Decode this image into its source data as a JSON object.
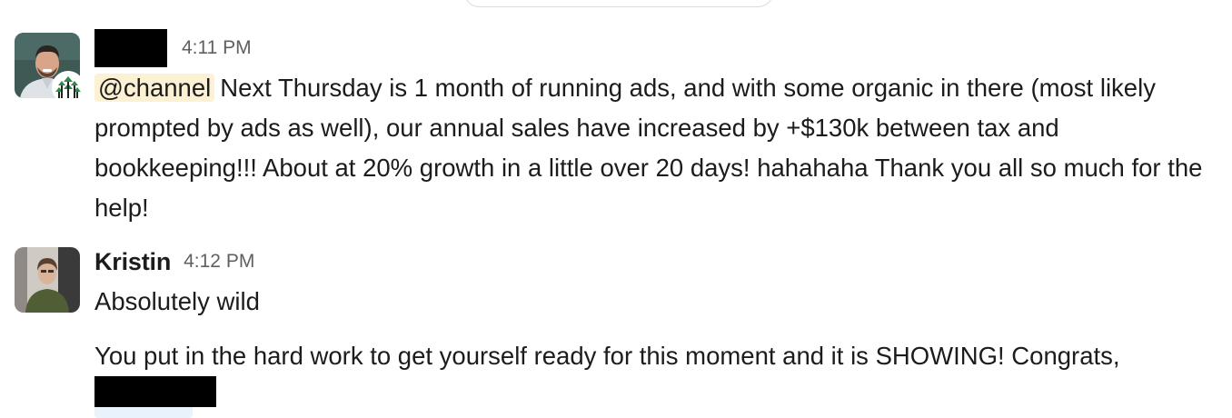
{
  "messages": [
    {
      "author": "",
      "author_redacted": true,
      "time": "4:11 PM",
      "mention": "@channel",
      "text": "Next Thursday is 1 month of running ads, and with some organic in there (most likely prompted by ads as well), our annual sales have increased by +$130k between tax and bookkeeping!!!  About at 20% growth in a little over 20 days! hahahaha Thank you all so much for the help!"
    },
    {
      "author": "Kristin",
      "time": "4:12 PM",
      "paragraphs": [
        "Absolutely wild",
        "You put in the hard work to get yourself ready for this moment and it is SHOWING! Congrats,"
      ],
      "trailing_mention_redacted": true
    }
  ],
  "colors": {
    "mention_bg": "#fdf1d4",
    "time": "#616061",
    "text": "#1d1c1d"
  }
}
